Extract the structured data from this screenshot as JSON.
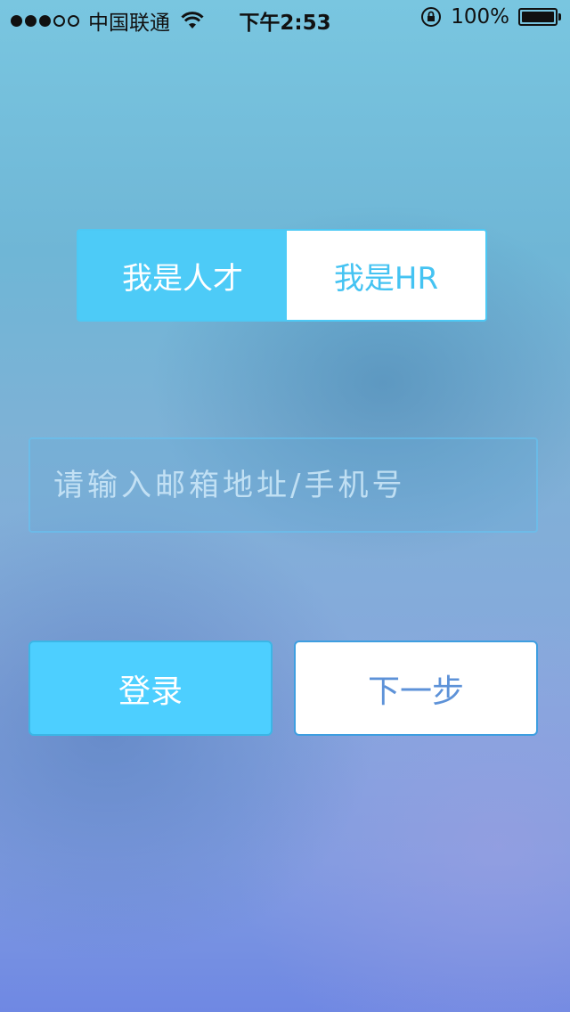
{
  "status_bar": {
    "carrier": "中国联通",
    "signal_strength": 3,
    "signal_max": 5,
    "time": "下午2:53",
    "battery": "100%"
  },
  "role_switch": {
    "options": [
      {
        "label": "我是人才",
        "selected": true
      },
      {
        "label": "我是HR",
        "selected": false
      }
    ]
  },
  "account_field": {
    "placeholder": "请输入邮箱地址/手机号",
    "value": ""
  },
  "actions": {
    "login_label": "登录",
    "next_label": "下一步"
  },
  "colors": {
    "accent": "#4dcbf7",
    "next_text": "#5d92d8"
  }
}
